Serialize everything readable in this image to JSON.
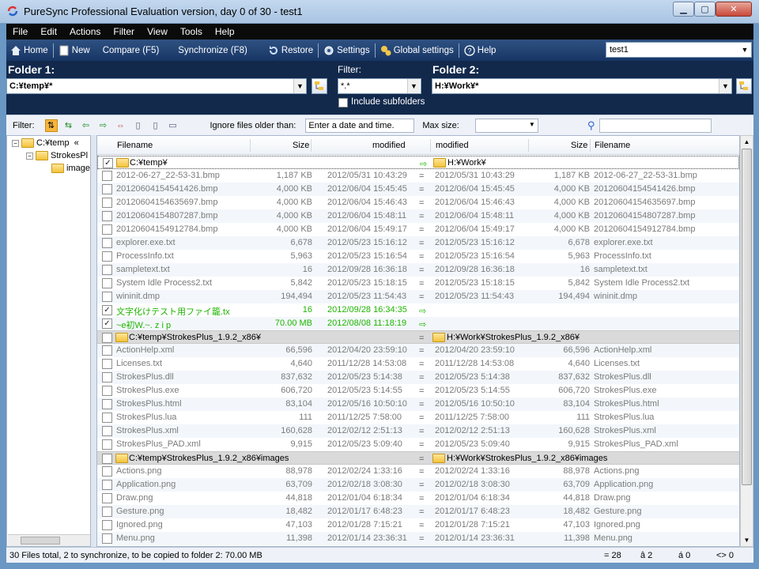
{
  "window": {
    "title": "PureSync Professional  Evaluation version, day 0 of 30  -  test1"
  },
  "menu": [
    "File",
    "Edit",
    "Actions",
    "Filter",
    "View",
    "Tools",
    "Help"
  ],
  "toolbar": {
    "home": "Home",
    "new": "New",
    "compare": "Compare (F5)",
    "synchronize": "Synchronize (F8)",
    "restore": "Restore",
    "settings": "Settings",
    "global_settings": "Global settings",
    "help": "Help",
    "profile": "test1"
  },
  "folder1": {
    "label": "Folder 1:",
    "value": "C:¥temp¥*"
  },
  "filter": {
    "label": "Filter:",
    "value": "*.*",
    "include_subfolders": "Include subfolders"
  },
  "folder2": {
    "label": "Folder 2:",
    "value": "H:¥Work¥*"
  },
  "filterbar": {
    "label": "Filter:",
    "ignore_label": "Ignore files older than:",
    "date_placeholder": "Enter a date and time.",
    "max_size_label": "Max size:"
  },
  "tree": {
    "root": "C:¥temp",
    "child": "StrokesPl",
    "grandchild": "image",
    "collapse_glyph": "«"
  },
  "columns": {
    "filename1": "Filename",
    "size1": "Size",
    "modified1": "modified",
    "modified2": "modified",
    "size2": "Size",
    "filename2": "Filename"
  },
  "rows": [
    {
      "kind": "folder",
      "left": "C:¥temp¥",
      "right": "H:¥Work¥",
      "dir": "⇨",
      "checked": true,
      "selected": true
    },
    {
      "kind": "file",
      "name": "2012-06-27_22-53-31.bmp",
      "size": "1,187 KB",
      "mod": "2012/05/31 10:43:29",
      "dir": "=",
      "mod2": "2012/05/31 10:43:29",
      "size2": "1,187 KB",
      "name2": "2012-06-27_22-53-31.bmp"
    },
    {
      "kind": "file",
      "name": "20120604154541426.bmp",
      "size": "4,000 KB",
      "mod": "2012/06/04 15:45:45",
      "dir": "=",
      "mod2": "2012/06/04 15:45:45",
      "size2": "4,000 KB",
      "name2": "20120604154541426.bmp"
    },
    {
      "kind": "file",
      "name": "20120604154635697.bmp",
      "size": "4,000 KB",
      "mod": "2012/06/04 15:46:43",
      "dir": "=",
      "mod2": "2012/06/04 15:46:43",
      "size2": "4,000 KB",
      "name2": "20120604154635697.bmp"
    },
    {
      "kind": "file",
      "name": "20120604154807287.bmp",
      "size": "4,000 KB",
      "mod": "2012/06/04 15:48:11",
      "dir": "=",
      "mod2": "2012/06/04 15:48:11",
      "size2": "4,000 KB",
      "name2": "20120604154807287.bmp"
    },
    {
      "kind": "file",
      "name": "20120604154912784.bmp",
      "size": "4,000 KB",
      "mod": "2012/06/04 15:49:17",
      "dir": "=",
      "mod2": "2012/06/04 15:49:17",
      "size2": "4,000 KB",
      "name2": "20120604154912784.bmp"
    },
    {
      "kind": "file",
      "name": "explorer.exe.txt",
      "size": "6,678",
      "mod": "2012/05/23 15:16:12",
      "dir": "=",
      "mod2": "2012/05/23 15:16:12",
      "size2": "6,678",
      "name2": "explorer.exe.txt"
    },
    {
      "kind": "file",
      "name": "ProcessInfo.txt",
      "size": "5,963",
      "mod": "2012/05/23 15:16:54",
      "dir": "=",
      "mod2": "2012/05/23 15:16:54",
      "size2": "5,963",
      "name2": "ProcessInfo.txt"
    },
    {
      "kind": "file",
      "name": "sampletext.txt",
      "size": "16",
      "mod": "2012/09/28 16:36:18",
      "dir": "=",
      "mod2": "2012/09/28 16:36:18",
      "size2": "16",
      "name2": "sampletext.txt"
    },
    {
      "kind": "file",
      "name": "System Idle Process2.txt",
      "size": "5,842",
      "mod": "2012/05/23 15:18:15",
      "dir": "=",
      "mod2": "2012/05/23 15:18:15",
      "size2": "5,842",
      "name2": "System Idle Process2.txt"
    },
    {
      "kind": "file",
      "name": "wininit.dmp",
      "size": "194,494",
      "mod": "2012/05/23 11:54:43",
      "dir": "=",
      "mod2": "2012/05/23 11:54:43",
      "size2": "194,494",
      "name2": "wininit.dmp"
    },
    {
      "kind": "sync",
      "name": "文字化けテスト用ファイ籠.tx",
      "size": "16",
      "mod": "2012/09/28 16:34:35",
      "dir": "⇨",
      "mod2": "",
      "size2": "",
      "name2": "",
      "checked": true
    },
    {
      "kind": "sync",
      "name": "~e初W.~. z i p",
      "size": "70.00 MB",
      "mod": "2012/08/08 11:18:19",
      "dir": "⇨",
      "mod2": "",
      "size2": "",
      "name2": "",
      "checked": true
    },
    {
      "kind": "folder",
      "left": "C:¥temp¥StrokesPlus_1.9.2_x86¥",
      "right": "H:¥Work¥StrokesPlus_1.9.2_x86¥",
      "dir": "=",
      "checked": false
    },
    {
      "kind": "file",
      "name": "ActionHelp.xml",
      "size": "66,596",
      "mod": "2012/04/20 23:59:10",
      "dir": "=",
      "mod2": "2012/04/20 23:59:10",
      "size2": "66,596",
      "name2": "ActionHelp.xml"
    },
    {
      "kind": "file",
      "name": "Licenses.txt",
      "size": "4,640",
      "mod": "2011/12/28 14:53:08",
      "dir": "=",
      "mod2": "2011/12/28 14:53:08",
      "size2": "4,640",
      "name2": "Licenses.txt"
    },
    {
      "kind": "file",
      "name": "StrokesPlus.dll",
      "size": "837,632",
      "mod": "2012/05/23 5:14:38",
      "dir": "=",
      "mod2": "2012/05/23 5:14:38",
      "size2": "837,632",
      "name2": "StrokesPlus.dll"
    },
    {
      "kind": "file",
      "name": "StrokesPlus.exe",
      "size": "606,720",
      "mod": "2012/05/23 5:14:55",
      "dir": "=",
      "mod2": "2012/05/23 5:14:55",
      "size2": "606,720",
      "name2": "StrokesPlus.exe"
    },
    {
      "kind": "file",
      "name": "StrokesPlus.html",
      "size": "83,104",
      "mod": "2012/05/16 10:50:10",
      "dir": "=",
      "mod2": "2012/05/16 10:50:10",
      "size2": "83,104",
      "name2": "StrokesPlus.html"
    },
    {
      "kind": "file",
      "name": "StrokesPlus.lua",
      "size": "111",
      "mod": "2011/12/25 7:58:00",
      "dir": "=",
      "mod2": "2011/12/25 7:58:00",
      "size2": "111",
      "name2": "StrokesPlus.lua"
    },
    {
      "kind": "file",
      "name": "StrokesPlus.xml",
      "size": "160,628",
      "mod": "2012/02/12 2:51:13",
      "dir": "=",
      "mod2": "2012/02/12 2:51:13",
      "size2": "160,628",
      "name2": "StrokesPlus.xml"
    },
    {
      "kind": "file",
      "name": "StrokesPlus_PAD.xml",
      "size": "9,915",
      "mod": "2012/05/23 5:09:40",
      "dir": "=",
      "mod2": "2012/05/23 5:09:40",
      "size2": "9,915",
      "name2": "StrokesPlus_PAD.xml"
    },
    {
      "kind": "folder",
      "left": "C:¥temp¥StrokesPlus_1.9.2_x86¥images",
      "right": "H:¥Work¥StrokesPlus_1.9.2_x86¥images",
      "dir": "=",
      "checked": false
    },
    {
      "kind": "file",
      "name": "Actions.png",
      "size": "88,978",
      "mod": "2012/02/24 1:33:16",
      "dir": "=",
      "mod2": "2012/02/24 1:33:16",
      "size2": "88,978",
      "name2": "Actions.png"
    },
    {
      "kind": "file",
      "name": "Application.png",
      "size": "63,709",
      "mod": "2012/02/18 3:08:30",
      "dir": "=",
      "mod2": "2012/02/18 3:08:30",
      "size2": "63,709",
      "name2": "Application.png"
    },
    {
      "kind": "file",
      "name": "Draw.png",
      "size": "44,818",
      "mod": "2012/01/04 6:18:34",
      "dir": "=",
      "mod2": "2012/01/04 6:18:34",
      "size2": "44,818",
      "name2": "Draw.png"
    },
    {
      "kind": "file",
      "name": "Gesture.png",
      "size": "18,482",
      "mod": "2012/01/17 6:48:23",
      "dir": "=",
      "mod2": "2012/01/17 6:48:23",
      "size2": "18,482",
      "name2": "Gesture.png"
    },
    {
      "kind": "file",
      "name": "Ignored.png",
      "size": "47,103",
      "mod": "2012/01/28 7:15:21",
      "dir": "=",
      "mod2": "2012/01/28 7:15:21",
      "size2": "47,103",
      "name2": "Ignored.png"
    },
    {
      "kind": "file",
      "name": "Menu.png",
      "size": "11,398",
      "mod": "2012/01/14 23:36:31",
      "dir": "=",
      "mod2": "2012/01/14 23:36:31",
      "size2": "11,398",
      "name2": "Menu.png"
    }
  ],
  "status": {
    "summary": "30 Files total,  2 to synchronize,  to be copied to folder 2: 70.00 MB",
    "equal": "= 28",
    "c2": "â 2",
    "c3": "á 0",
    "c4": "<> 0"
  },
  "colors": {
    "sync_green": "#1eb400",
    "toolbar_blue": "#1f3f6e",
    "folder_panel": "#12294c",
    "menubar": "#0b0b0b"
  }
}
